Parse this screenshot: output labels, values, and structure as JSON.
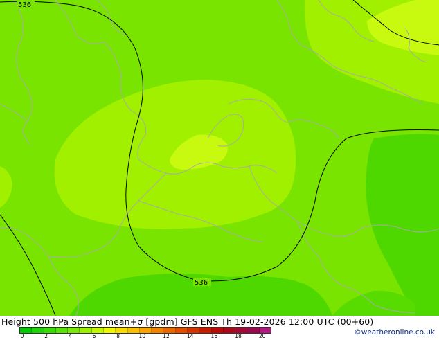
{
  "title": "Height 500 hPa Spread mean+σ [gpdm] GFS ENS Th 19-02-2026 12:00 UTC (00+60)",
  "credit": "©weatheronline.co.uk",
  "contour_label": "536",
  "colorbar": {
    "colors": [
      "#02c806",
      "#1ed10a",
      "#3cd80a",
      "#5ae00a",
      "#7ae80a",
      "#9cf000",
      "#c4f800",
      "#eef800",
      "#f8dc00",
      "#f8c000",
      "#f8a400",
      "#f08400",
      "#e86800",
      "#e04c00",
      "#d43400",
      "#c81c00",
      "#b80a08",
      "#a80a1c",
      "#a00a34",
      "#980a50",
      "#b01a80"
    ],
    "tick_labels": [
      "0",
      "2",
      "4",
      "6",
      "8",
      "10",
      "12",
      "14",
      "16",
      "18",
      "20"
    ]
  },
  "colors": {
    "base_field": "#78e400",
    "light_field": "#a0f000",
    "lightest_field": "#c8fa10",
    "dark_field": "#4ed800",
    "coastline": "#a9a9a9",
    "contour": "#000000"
  }
}
